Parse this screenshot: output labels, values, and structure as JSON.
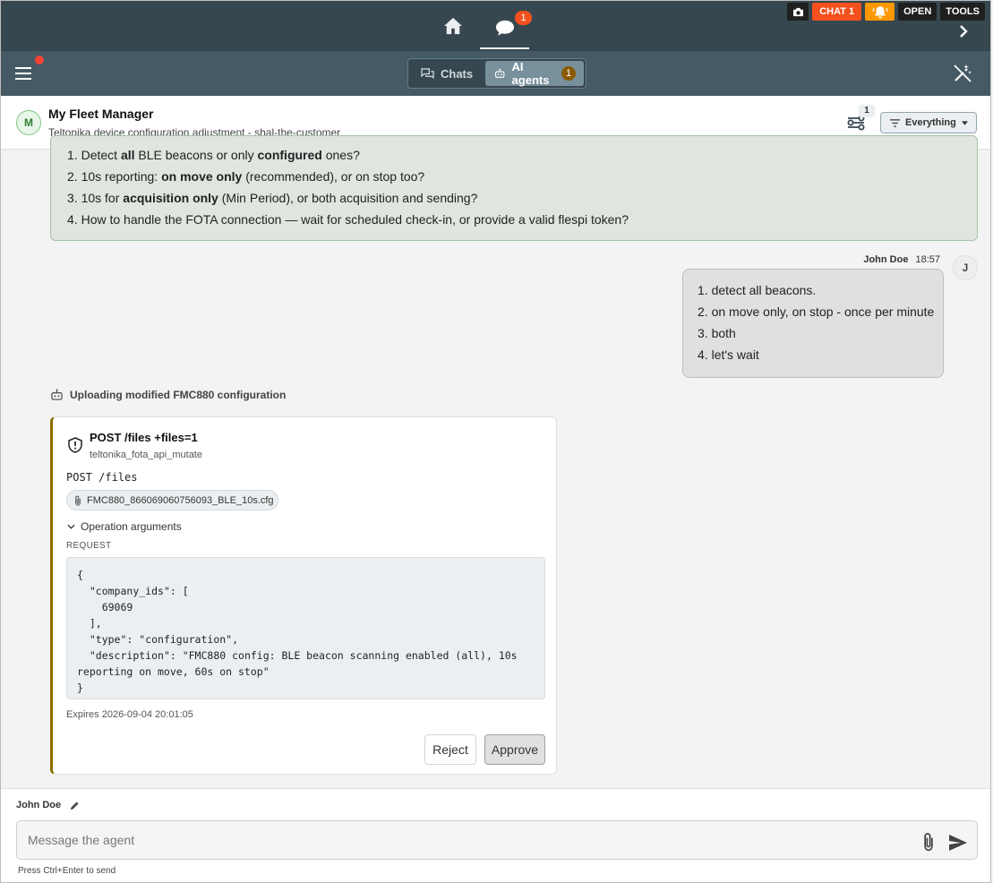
{
  "topbar": {
    "nav_badge": "1",
    "chat_btn": "CHAT 1",
    "open_btn": "OPEN",
    "tools_btn": "TOOLS"
  },
  "subbar": {
    "tabs": [
      {
        "label": "Chats"
      },
      {
        "label": "AI agents",
        "badge": "1"
      }
    ]
  },
  "chat_header": {
    "avatar": "M",
    "title": "My Fleet Manager",
    "subtitle": "Teltonika device configuration adjustment - shal-the-customer",
    "switch_badge": "1",
    "filter_label": "Everything"
  },
  "agent_message": {
    "items": [
      {
        "num": "1.",
        "pre": "Detect ",
        "b1": "all",
        "mid": " BLE beacons or only ",
        "b2": "configured",
        "post": " ones?"
      },
      {
        "num": "2.",
        "pre": "10s reporting: ",
        "b1": "on move only",
        "mid": " (recommended), or on stop too?",
        "b2": "",
        "post": ""
      },
      {
        "num": "3.",
        "pre": "10s for ",
        "b1": "acquisition only",
        "mid": " (Min Period), or both acquisition and sending?",
        "b2": "",
        "post": ""
      },
      {
        "num": "4.",
        "pre": "How to handle the FOTA connection — wait for scheduled check-in, or provide a valid flespi token?",
        "b1": "",
        "mid": "",
        "b2": "",
        "post": ""
      }
    ]
  },
  "user_message": {
    "author": "John Doe",
    "time": "18:57",
    "avatar": "J",
    "items": [
      {
        "num": "1.",
        "text": "detect all beacons."
      },
      {
        "num": "2.",
        "text": "on move only, on stop - once per minute"
      },
      {
        "num": "3.",
        "text": "both"
      },
      {
        "num": "4.",
        "text": "let's wait"
      }
    ]
  },
  "tool_status": "Uploading modified FMC880 configuration",
  "approval_card": {
    "title": "POST /files +files=1",
    "subtitle": "teltonika_fota_api_mutate",
    "endpoint": "POST /files",
    "file": "FMC880_866069060756093_BLE_10s.cfg",
    "args_label": "Operation arguments",
    "request_label": "REQUEST",
    "request_body": "{\n  \"company_ids\": [\n    69069\n  ],\n  \"type\": \"configuration\",\n  \"description\": \"FMC880 config: BLE beacon scanning enabled (all), 10s reporting on move, 60s on stop\"\n}",
    "expires": "Expires 2026-09-04 20:01:05",
    "reject": "Reject",
    "approve": "Approve"
  },
  "composer": {
    "user": "John Doe",
    "placeholder": "Message the agent",
    "hint": "Press Ctrl+Enter to send"
  },
  "colors": {
    "topbar": "#37474f",
    "subbar": "#455a64",
    "badge_orange": "#f4511e",
    "bell_orange": "#ff9800",
    "agent_bg": "#dfe5df",
    "card_accent": "#8a6d00"
  },
  "icons": {
    "home": "home-icon",
    "chat": "chat-bubble-icon",
    "camera": "camera-icon",
    "bell": "bell-icon",
    "chevron": "chevron-right-icon",
    "menu": "menu-icon",
    "wand": "magic-wand-off-icon",
    "robot": "robot-icon",
    "shield": "shield-alert-icon",
    "clip": "paperclip-icon",
    "send": "send-icon"
  }
}
